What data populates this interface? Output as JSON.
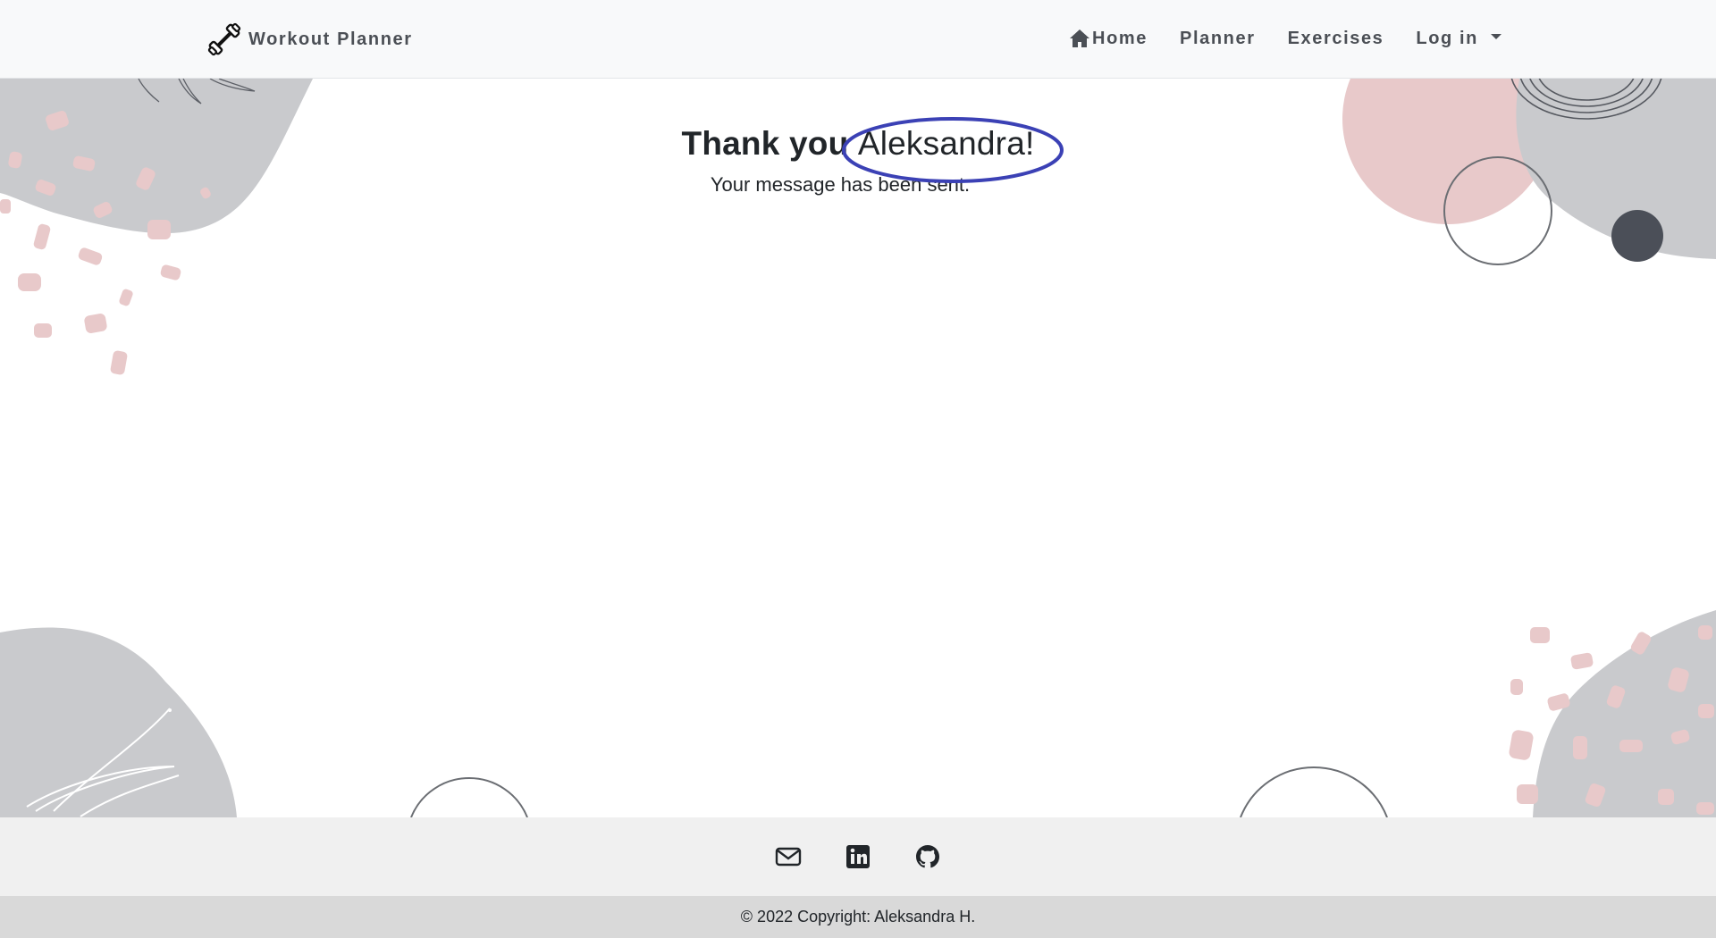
{
  "navbar": {
    "brand": {
      "icon": "dumbbell-icon",
      "text": "Workout Planner"
    },
    "links": [
      {
        "label": "Home",
        "icon": "home-icon"
      },
      {
        "label": "Planner"
      },
      {
        "label": "Exercises"
      },
      {
        "label": "Log in",
        "dropdown": true
      }
    ]
  },
  "main": {
    "heading_prefix": "Thank you ",
    "heading_name": "Aleksandra!",
    "subtext": "Your message has been sent.",
    "highlight_color": "#3b41b5"
  },
  "footer": {
    "social": [
      {
        "icon": "envelope-icon",
        "label": "Email"
      },
      {
        "icon": "linkedin-icon",
        "label": "LinkedIn"
      },
      {
        "icon": "github-icon",
        "label": "GitHub"
      }
    ],
    "copyright": "© 2022 Copyright: Aleksandra H."
  },
  "colors": {
    "navbar_bg": "#f8f9fa",
    "blob_gray": "#c9cacd",
    "blob_pink": "#e8c9ca",
    "dot_dark": "#4b4f58",
    "footer_bg": "#f0f0f0",
    "copyright_bg": "#d9d9d9"
  }
}
